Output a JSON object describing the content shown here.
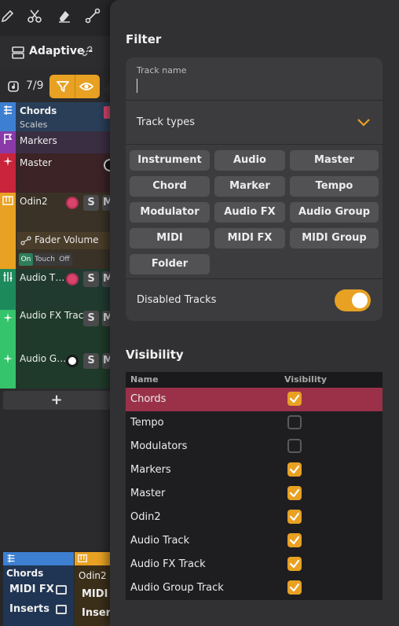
{
  "project": {
    "title": "Adaptive -",
    "link_icon": "link-icon"
  },
  "track_count": "7/9",
  "tracks": {
    "chords": {
      "name": "Chords",
      "sub": "Scales",
      "color": "#3d7fd1"
    },
    "markers": {
      "name": "Markers",
      "color": "#8a3aa8"
    },
    "master": {
      "name": "Master",
      "color": "#c8243c"
    },
    "odin2": {
      "name": "Odin2",
      "color": "#e8a122",
      "automation": {
        "label": "Fader Volume",
        "on": "On",
        "touch": "Touch",
        "off": "Off"
      }
    },
    "audio_track": {
      "name": "Audio T…",
      "color": "#1d8a5c"
    },
    "audio_fx": {
      "name": "Audio FX Track",
      "color": "#35c46b"
    },
    "audio_group": {
      "name": "Audio G…",
      "color": "#35c46b"
    }
  },
  "buttons": {
    "solo": "S",
    "mute": "M"
  },
  "add_track": "+",
  "bottom": {
    "chords_label": "Chords",
    "midi_fx": "MIDI FX",
    "inserts": "Inserts",
    "odin_label": "Odin2",
    "odin_midi": "MIDI I",
    "odin_inserts": "Insert"
  },
  "filter": {
    "title": "Filter",
    "track_name_label": "Track name",
    "track_name_value": "",
    "track_types_label": "Track types",
    "chips": [
      "Instrument",
      "Audio",
      "Master",
      "Chord",
      "Marker",
      "Tempo",
      "Modulator",
      "Audio FX",
      "Audio Group",
      "MIDI",
      "MIDI FX",
      "MIDI Group",
      "Folder"
    ],
    "disabled_tracks_label": "Disabled Tracks",
    "disabled_tracks_on": true
  },
  "visibility": {
    "title": "Visibility",
    "col_name": "Name",
    "col_visibility": "Visibility",
    "rows": [
      {
        "name": "Chords",
        "visible": true,
        "selected": true
      },
      {
        "name": "Tempo",
        "visible": false,
        "selected": false
      },
      {
        "name": "Modulators",
        "visible": false,
        "selected": false
      },
      {
        "name": "Markers",
        "visible": true,
        "selected": false
      },
      {
        "name": "Master",
        "visible": true,
        "selected": false
      },
      {
        "name": "Odin2",
        "visible": true,
        "selected": false
      },
      {
        "name": "Audio Track",
        "visible": true,
        "selected": false
      },
      {
        "name": "Audio FX Track",
        "visible": true,
        "selected": false
      },
      {
        "name": "Audio Group Track",
        "visible": true,
        "selected": false
      }
    ]
  },
  "colors": {
    "accent": "#e8a122",
    "selected_row": "#9a3149"
  }
}
